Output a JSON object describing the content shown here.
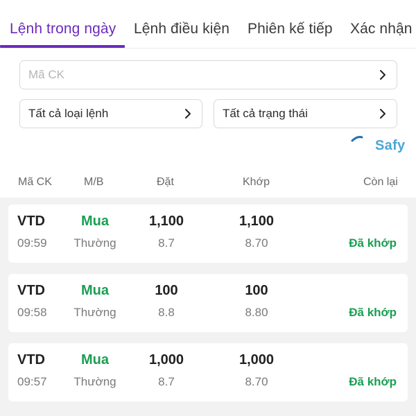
{
  "tabs": [
    {
      "label": "Lệnh trong ngày",
      "active": true
    },
    {
      "label": "Lệnh điều kiện",
      "active": false
    },
    {
      "label": "Phiên kế tiếp",
      "active": false
    },
    {
      "label": "Xác nhận l",
      "active": false
    }
  ],
  "filters": {
    "symbol_placeholder": "Mã CK",
    "order_type": "Tất cả loại lệnh",
    "status": "Tất cả trạng thái"
  },
  "logo": {
    "text": "Safy"
  },
  "columns": {
    "symbol": "Mã CK",
    "side": "M/B",
    "placed": "Đặt",
    "matched": "Khớp",
    "remaining": "Còn lại"
  },
  "orders": [
    {
      "symbol": "VTD",
      "time": "09:59",
      "side": "Mua",
      "type": "Thường",
      "placed_qty": "1,100",
      "placed_price": "8.7",
      "matched_qty": "1,100",
      "matched_price": "8.70",
      "status": "Đã khớp"
    },
    {
      "symbol": "VTD",
      "time": "09:58",
      "side": "Mua",
      "type": "Thường",
      "placed_qty": "100",
      "placed_price": "8.8",
      "matched_qty": "100",
      "matched_price": "8.80",
      "status": "Đã khớp"
    },
    {
      "symbol": "VTD",
      "time": "09:57",
      "side": "Mua",
      "type": "Thường",
      "placed_qty": "1,000",
      "placed_price": "8.7",
      "matched_qty": "1,000",
      "matched_price": "8.70",
      "status": "Đã khớp"
    }
  ],
  "colors": {
    "accent": "#6a2bbd",
    "buy": "#1a9e52",
    "matched": "#1a9e52",
    "logo": "#4ba6d6"
  }
}
